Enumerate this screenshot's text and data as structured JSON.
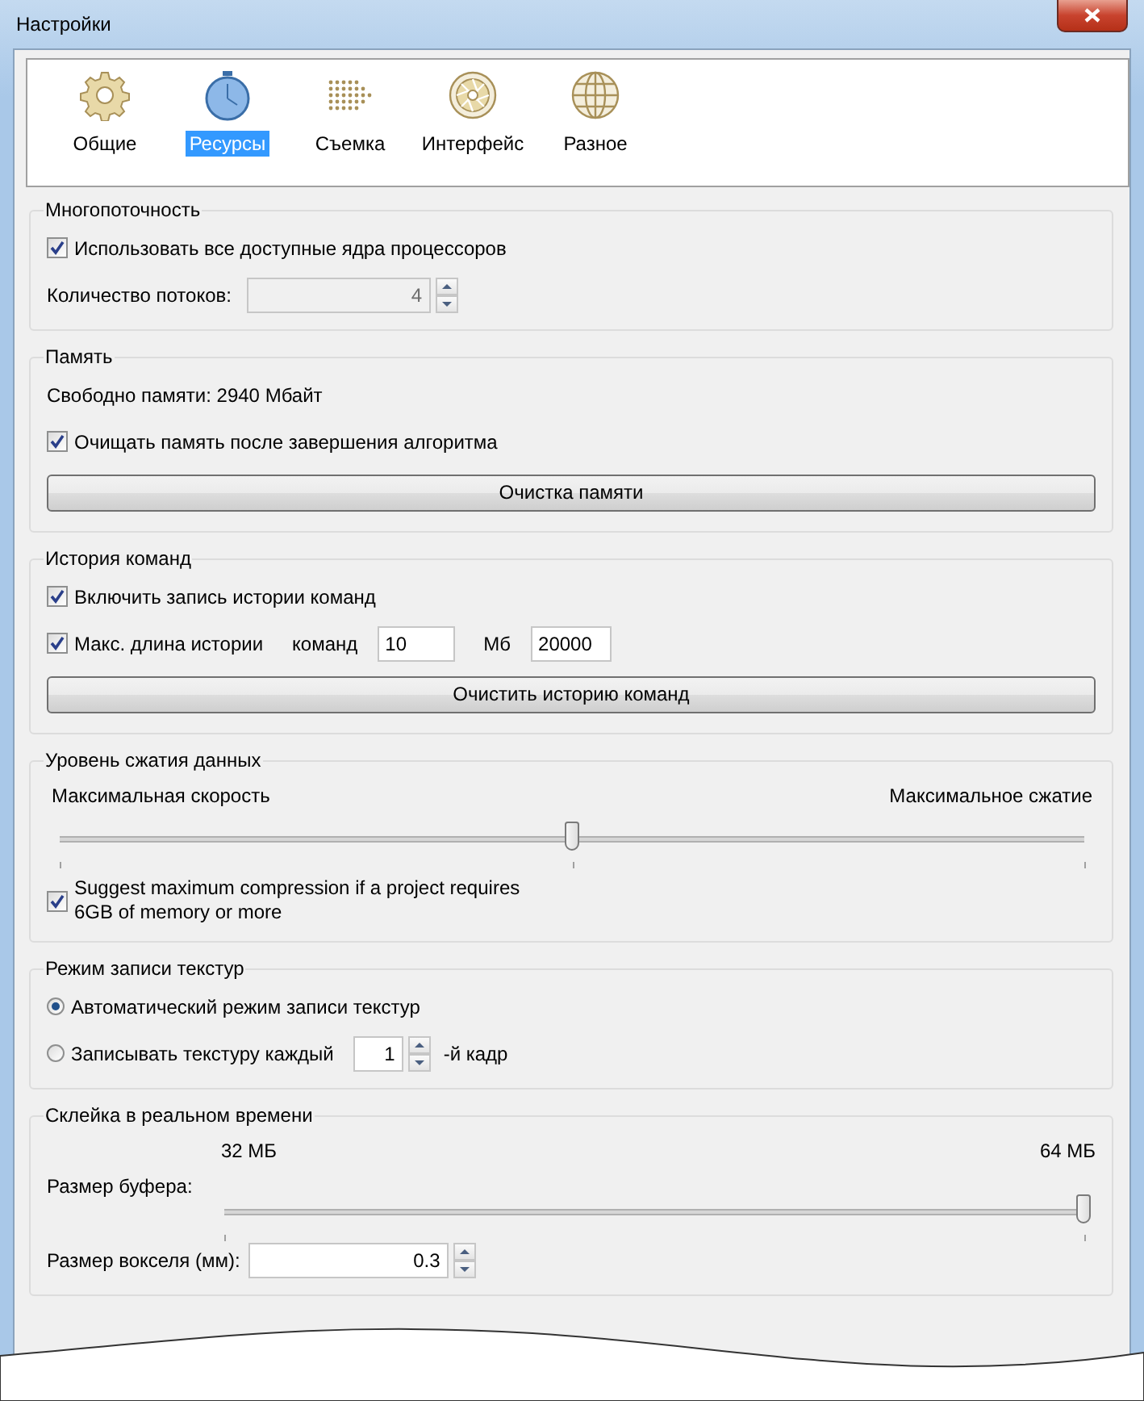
{
  "window": {
    "title": "Настройки"
  },
  "toolbar": {
    "items": [
      {
        "label": "Общие",
        "selected": false
      },
      {
        "label": "Ресурсы",
        "selected": true
      },
      {
        "label": "Съемка",
        "selected": false
      },
      {
        "label": "Интерфейс",
        "selected": false
      },
      {
        "label": "Разное",
        "selected": false
      }
    ]
  },
  "groups": [
    {
      "title": "Многопоточность",
      "rows": [
        {
          "kind": "checkbox",
          "label": "Использовать все доступные ядра процессоров",
          "checked": true
        },
        {
          "kind": "spin",
          "label": "Количество потоков:",
          "value": "4",
          "disabled": true
        }
      ]
    },
    {
      "title": "Память",
      "rows": [
        {
          "kind": "text",
          "label": "Свободно памяти: 2940 Мбайт"
        },
        {
          "kind": "checkbox",
          "label": "Очищать память после завершения алгоритма",
          "checked": true
        },
        {
          "kind": "button",
          "label": "Очистка памяти"
        }
      ]
    },
    {
      "title": "История команд",
      "rows": [
        {
          "kind": "checkbox",
          "label": "Включить запись истории команд",
          "checked": true
        },
        {
          "kind": "checkbox_fields",
          "label": "Макс. длина истории",
          "checked": true,
          "fields": [
            {
              "label": "команд",
              "value": "10"
            },
            {
              "label": "Мб",
              "value": "20000"
            }
          ]
        },
        {
          "kind": "button",
          "label": "Очистить историю команд"
        }
      ]
    },
    {
      "title": "Уровень сжатия данных",
      "rows": [
        {
          "kind": "slider",
          "min_label": "Максимальная скорость",
          "max_label": "Максимальное сжатие",
          "level": 0.5
        },
        {
          "kind": "checkbox",
          "label": "Suggest maximum compression if a project requires 6GB of memory or more",
          "checked": true
        }
      ]
    },
    {
      "title": "Режим записи текстур",
      "rows": [
        {
          "kind": "radio",
          "label": "Автоматический режим записи текстур",
          "selected": true
        },
        {
          "kind": "radio",
          "label": "Записывать текстуру каждый",
          "selected": false,
          "value": "1",
          "suffix": "-й кадр"
        }
      ]
    },
    {
      "title": "Склейка в реальном времени",
      "rows": [
        {
          "kind": "slider",
          "label": "Размер буфера:",
          "min_label": "32 МБ",
          "max_label": "64 МБ",
          "level": 1
        },
        {
          "kind": "spin",
          "label": "Размер вокселя (мм):",
          "value": "0.3",
          "disabled": false
        }
      ]
    }
  ]
}
